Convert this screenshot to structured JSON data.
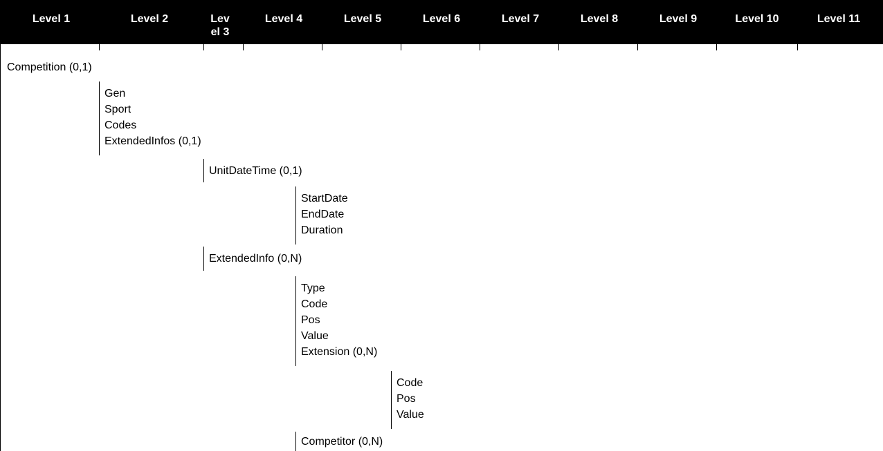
{
  "header": {
    "levels": [
      "Level 1",
      "Level 2",
      "Lev el 3",
      "Level 4",
      "Level 5",
      "Level 6",
      "Level 7",
      "Level 8",
      "Level 9",
      "Level 10",
      "Level 11"
    ]
  },
  "rows": {
    "competition": "Competition (0,1)",
    "gen": "Gen",
    "sport": "Sport",
    "codes": "Codes",
    "extended_infos": "ExtendedInfos (0,1)",
    "unit_date_time": "UnitDateTime (0,1)",
    "start_date": "StartDate",
    "end_date": "EndDate",
    "duration": "Duration",
    "extended_info": "ExtendedInfo (0,N)",
    "type": "Type",
    "code": "Code",
    "pos": "Pos",
    "value": "Value",
    "extension": "Extension (0,N)",
    "ext_code": "Code",
    "ext_pos": "Pos",
    "ext_value": "Value",
    "competitor": "Competitor (0,N)"
  }
}
